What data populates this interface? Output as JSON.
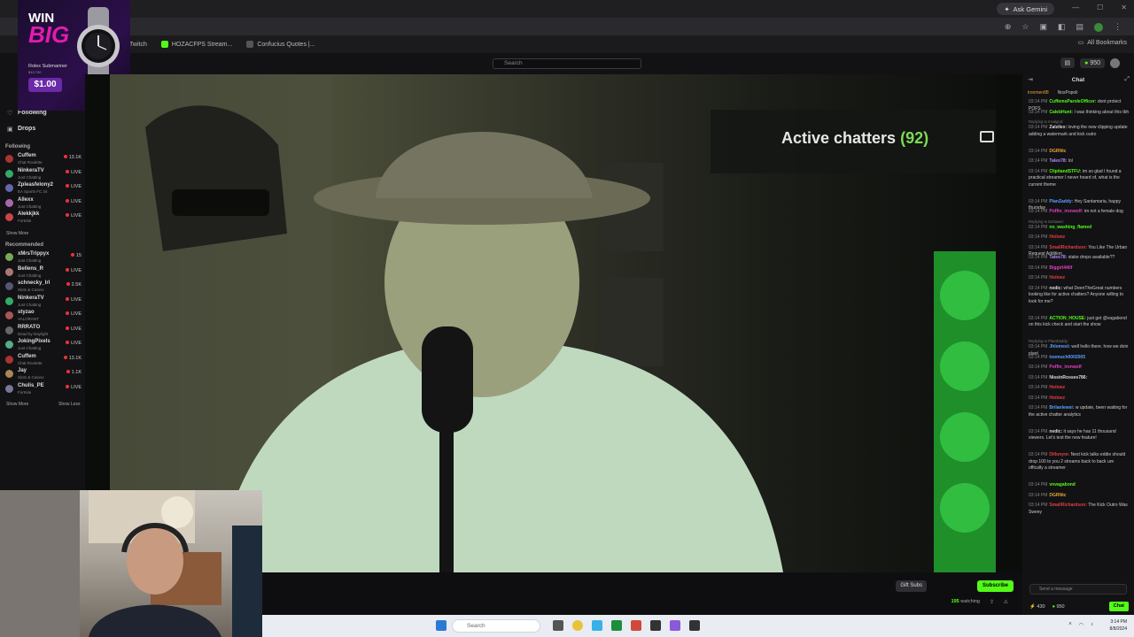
{
  "browser": {
    "tabs": [
      "Twitch",
      "HOZACFPS Stream...",
      "Confucius Quotes |..."
    ],
    "ask_gemini": "Ask Gemini",
    "all_bookmarks": "All Bookmarks",
    "stats": [
      "0%",
      "100"
    ]
  },
  "ad": {
    "line1": "WIN",
    "line2": "BIG",
    "product": "Rolex Submariner",
    "product_value": "$10,700",
    "price": "$1.00"
  },
  "header": {
    "search_placeholder": "Search",
    "balance": "950"
  },
  "sidebar": {
    "following_link": "Following",
    "drops_link": "Drops",
    "following_title": "Following",
    "following": [
      {
        "name": "Cuffem",
        "game": "Chat Roulette",
        "status": "13.1K",
        "color": "#a33"
      },
      {
        "name": "NinkeraTV",
        "game": "Just Chatting",
        "status": "LIVE",
        "color": "#3a6"
      },
      {
        "name": "Zpleasfelony2",
        "game": "EA Sports FC 24",
        "status": "LIVE",
        "color": "#66a"
      },
      {
        "name": "Allexx",
        "game": "Just Chatting",
        "status": "LIVE",
        "color": "#a6a"
      },
      {
        "name": "Alekkjkk",
        "game": "Fortnite",
        "status": "LIVE",
        "color": "#c44"
      }
    ],
    "show_more_1": "Show More",
    "recommended_title": "Recommended",
    "recommended": [
      {
        "name": "xMrsTrippyx",
        "game": "Just Chatting",
        "status": "15",
        "color": "#7a5"
      },
      {
        "name": "Bellens_R",
        "game": "Just Chatting",
        "status": "LIVE",
        "color": "#a77"
      },
      {
        "name": "schnecky_lrl",
        "game": "Slots & Casino",
        "status": "2.5K",
        "color": "#557"
      },
      {
        "name": "NinkeraTV",
        "game": "Just Chatting",
        "status": "LIVE",
        "color": "#3a6"
      },
      {
        "name": "styzao",
        "game": "VALORANT",
        "status": "LIVE",
        "color": "#a55"
      },
      {
        "name": "RRRATO",
        "game": "Dead by Daylight",
        "status": "LIVE",
        "color": "#666"
      },
      {
        "name": "JokingPixels",
        "game": "Just Chatting",
        "status": "LIVE",
        "color": "#5a8"
      },
      {
        "name": "Cuffem",
        "game": "Chat Roulette",
        "status": "13.1K",
        "color": "#a33"
      },
      {
        "name": "Jay",
        "game": "Slots & Casino",
        "status": "1.1K",
        "color": "#a85"
      },
      {
        "name": "Chulis_PE",
        "game": "Fortnite",
        "status": "LIVE",
        "color": "#779"
      }
    ],
    "show_more_2": "Show More",
    "show_less": "Show Less"
  },
  "video": {
    "chatters_label": "Active chatters",
    "chatters_count": "(92)"
  },
  "below_video": {
    "gift_label": "Gift Subs",
    "subscribe_label": "Subscribe",
    "watching_count": "195",
    "watching_label": "watching"
  },
  "chat": {
    "title": "Chat",
    "pinned": [
      "ironmen88",
      "NoxPopoli"
    ],
    "messages": [
      {
        "time": "03:14 PM",
        "user": "CuffemsParoleOfficer:",
        "text": "dont protect POFS",
        "color": "#53fc18"
      },
      {
        "time": "03:14 PM",
        "user": "CalebHunt:",
        "text": "I was thinking about this tbh",
        "color": "#53fc18"
      },
      {
        "time": "03:14 PM",
        "user": "Zalzilex:",
        "text": "loving the new clipping update adding a watermark and kick outro",
        "color": "#ddd"
      },
      {
        "time": "03:14 PM",
        "user": "DGRNtc",
        "text": "",
        "color": "#e8a33a"
      },
      {
        "time": "03:14 PM",
        "user": "Taleo78:",
        "text": "lol",
        "color": "#b08cff"
      },
      {
        "time": "03:14 PM",
        "user": "ClipitandSTFU:",
        "text": "im so glad I found a practical streamer I never heard of, what is the current theme",
        "color": "#53fc18"
      },
      {
        "time": "03:14 PM",
        "user": "PlanZaddy:",
        "text": "Hey Santamaria, happy thursday",
        "color": "#5aa0ff"
      },
      {
        "time": "03:14 PM",
        "user": "Poffin_ironwolf:",
        "text": "im not a female dog",
        "color": "#e040c0"
      },
      {
        "time": "03:14 PM",
        "user": "no_washing_flamed",
        "text": "",
        "color": "#53fc18"
      },
      {
        "time": "03:14 PM",
        "user": "Hoiioez",
        "text": "",
        "color": "#e04040"
      },
      {
        "time": "03:14 PM",
        "user": "SmallRichardson:",
        "text": "You Like The Urban Request Addition",
        "color": "#e04040"
      },
      {
        "time": "03:14 PM",
        "user": "Taleo78:",
        "text": "stake drops available??",
        "color": "#b08cff"
      },
      {
        "time": "03:14 PM",
        "user": "Biggirl44lif",
        "text": "",
        "color": "#e040c0"
      },
      {
        "time": "03:14 PM",
        "user": "Hoiioez",
        "text": "",
        "color": "#e04040"
      },
      {
        "time": "03:14 PM",
        "user": "nedic:",
        "text": "what DeenTheGreat numbers looking like for active chatters? Anyone willing to look for me?",
        "color": "#ddd"
      },
      {
        "time": "03:14 PM",
        "user": "ACTION_HOUSE:",
        "text": "just get @vagabond on this kick check and start the show",
        "color": "#53fc18"
      },
      {
        "time": "03:14 PM",
        "user": "Jhlomest:",
        "text": "well hello there. how we doin plant",
        "color": "#5aa0ff"
      },
      {
        "time": "03:14 PM",
        "user": "toomuch0002005",
        "text": "",
        "color": "#5aa0ff"
      },
      {
        "time": "03:14 PM",
        "user": "Poffin_ironwolf",
        "text": "",
        "color": "#e040c0"
      },
      {
        "time": "03:14 PM",
        "user": "NissinRosses786:",
        "text": "",
        "color": "#ddd"
      },
      {
        "time": "03:14 PM",
        "user": "Hoiioez",
        "text": "",
        "color": "#e04040"
      },
      {
        "time": "03:14 PM",
        "user": "Hoiioez",
        "text": "",
        "color": "#e04040"
      },
      {
        "time": "03:14 PM",
        "user": "Brilanlewsi:",
        "text": "w update, been waiting for the active chatter analytics",
        "color": "#5aa0ff"
      },
      {
        "time": "03:14 PM",
        "user": "nedic:",
        "text": "it says he has 11 thousand viewers. Let's test the new feature!",
        "color": "#ddd"
      },
      {
        "time": "03:14 PM",
        "user": "Dillonym:",
        "text": "Next kick talks eddie should drop 100 to you 2 streams back to back ure offically a streamer",
        "color": "#e04040"
      },
      {
        "time": "03:14 PM",
        "user": "vnvagabond",
        "text": "",
        "color": "#53fc18"
      },
      {
        "time": "03:14 PM",
        "user": "DGRNtc",
        "text": "",
        "color": "#e8a33a"
      },
      {
        "time": "03:14 PM",
        "user": "SmallRichardson:",
        "text": "The Kick Outro Was Sweey",
        "color": "#e04040"
      }
    ],
    "replies": [
      "Replying to Invalgod:",
      "Replying to Duhawet:",
      "Replying to PlantDaddy:"
    ],
    "input_placeholder": "Send a message",
    "foot_count": "430",
    "foot_balance": "950",
    "send_label": "Chat"
  },
  "taskbar": {
    "search_placeholder": "Search",
    "time": "3:14 PM",
    "date": "8/8/2024"
  }
}
